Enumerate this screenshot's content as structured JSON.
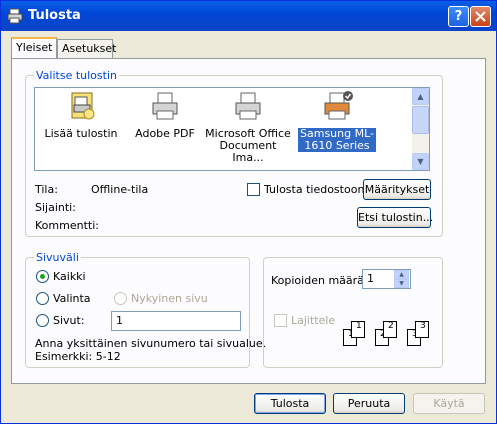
{
  "window": {
    "title": "Tulosta",
    "help_label": "?",
    "close_label": "✕"
  },
  "tabs": [
    {
      "label": "Yleiset"
    },
    {
      "label": "Asetukset"
    }
  ],
  "select_printer": {
    "legend": "Valitse tulostin",
    "printers": [
      {
        "label": "Lisää tulostin",
        "icon": "add-printer-icon"
      },
      {
        "label": "Adobe PDF",
        "icon": "printer-icon"
      },
      {
        "label": "Microsoft Office Document Ima...",
        "icon": "printer-icon"
      },
      {
        "label": "Samsung ML-1610 Series",
        "icon": "default-printer-icon",
        "selected": true
      }
    ],
    "status_label": "Tila:",
    "status_value": "Offline-tila",
    "location_label": "Sijainti:",
    "comment_label": "Kommentti:",
    "print_to_file_label": "Tulosta tiedostoon",
    "preferences_button": "Määritykset",
    "find_printer_button": "Etsi tulostin..."
  },
  "page_range": {
    "legend": "Sivuväli",
    "all_label": "Kaikki",
    "selection_label": "Valinta",
    "current_page_label": "Nykyinen sivu",
    "pages_label": "Sivut:",
    "pages_value": "1",
    "hint_line1": "Anna yksittäinen sivunumero tai sivualue.",
    "hint_line2": "Esimerkki: 5-12",
    "selected_option": "all"
  },
  "copies": {
    "count_label": "Kopioiden määrä:",
    "count_value": "1",
    "collate_label": "Lajittele",
    "collate_checked": false,
    "page_numbers": [
      "1",
      "1",
      "2",
      "2",
      "3",
      "3"
    ]
  },
  "footer": {
    "print_button": "Tulosta",
    "cancel_button": "Peruuta",
    "apply_button": "Käytä"
  },
  "colors": {
    "titlebar": "#0A5FE8",
    "accent": "#0046D5",
    "selection": "#316AC5",
    "window_bg": "#ECE9D8"
  }
}
